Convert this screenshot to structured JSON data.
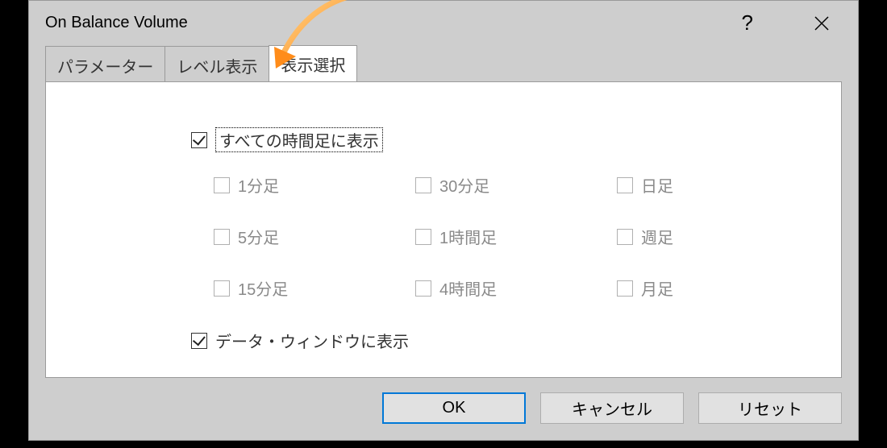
{
  "dialog": {
    "title": "On Balance Volume"
  },
  "tabs": [
    {
      "label": "パラメーター"
    },
    {
      "label": "レベル表示"
    },
    {
      "label": "表示選択"
    }
  ],
  "checkboxes": {
    "allTimeframes": "すべての時間足に表示",
    "dataWindow": "データ・ウィンドウに表示",
    "items": [
      {
        "label": "1分足"
      },
      {
        "label": "30分足"
      },
      {
        "label": "日足"
      },
      {
        "label": "5分足"
      },
      {
        "label": "1時間足"
      },
      {
        "label": "週足"
      },
      {
        "label": "15分足"
      },
      {
        "label": "4時間足"
      },
      {
        "label": "月足"
      }
    ]
  },
  "buttons": {
    "ok": "OK",
    "cancel": "キャンセル",
    "reset": "リセット"
  }
}
